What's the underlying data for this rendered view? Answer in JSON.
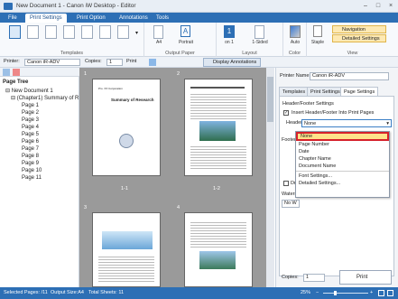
{
  "title": "New Document 1 - Canon iW Desktop - Editor",
  "tabs": [
    {
      "label": "File"
    },
    {
      "label": "Print Settings"
    },
    {
      "label": "Print Option"
    },
    {
      "label": "Annotations"
    },
    {
      "label": "Tools"
    }
  ],
  "ribbon": {
    "groups": {
      "templates": "Templates",
      "output_paper": "Output Paper",
      "layout": "Layout",
      "color": "Color",
      "view": "View"
    },
    "paper_size": "A4",
    "orientation": "Portrait",
    "pages_per_sheet": "1",
    "pages_per_sheet_sub": "on 1",
    "sided": "1-Sided",
    "color_mode": "Auto",
    "staple": "Staple",
    "navigation": "Navigation",
    "detailed_settings": "Detailed Settings"
  },
  "toolbar": {
    "printer_label": "Printer:",
    "printer_value": "Canon iR-ADV",
    "copies_label": "Copies:",
    "copies_value": "1",
    "print_label": "Print",
    "display_annotations": "Display Annotations"
  },
  "page_tree": {
    "title": "Page Tree",
    "root": "New Document 1",
    "chapter": "(Chapter1) Summary of R",
    "pages": [
      "Page 1",
      "Page 2",
      "Page 3",
      "Page 4",
      "Page 5",
      "Page 6",
      "Page 7",
      "Page 8",
      "Page 9",
      "Page 10",
      "Page 11"
    ]
  },
  "preview": {
    "labels": [
      "1",
      "2",
      "3",
      "4"
    ],
    "captions": [
      "1-1",
      "1-2"
    ],
    "page1_company": "Pro. XX Corporation",
    "page1_title": "Summary of Research"
  },
  "right_panel": {
    "printer_name_label": "Printer Name:",
    "printer_name_value": "Canon iR-ADV",
    "tabs": [
      "Templates",
      "Print Settings",
      "Page Settings"
    ],
    "section": "Header/Footer Settings",
    "insert_checkbox": "Insert Header/Footer Into Print Pages",
    "header_label": "Header:",
    "header_value": "None",
    "footer_label": "Footer:",
    "draw_label": "Draw",
    "watermark_label": "Waterm",
    "watermark_value": "No W",
    "copies_label": "Copies:",
    "copies_value": "1",
    "print_button": "Print"
  },
  "dropdown_options": [
    "None",
    "Page Number",
    "Date",
    "Chapter Name",
    "Document Name",
    "Font Settings...",
    "Detailed Settings..."
  ],
  "status": {
    "selected": "Selected Pages: /11",
    "output": "Output Size:A4",
    "total": "Total Sheets: 11",
    "zoom": "25%"
  },
  "colors": {
    "accent": "#2d6fb5",
    "highlight": "#d6202a",
    "selection": "#ffe28a"
  }
}
